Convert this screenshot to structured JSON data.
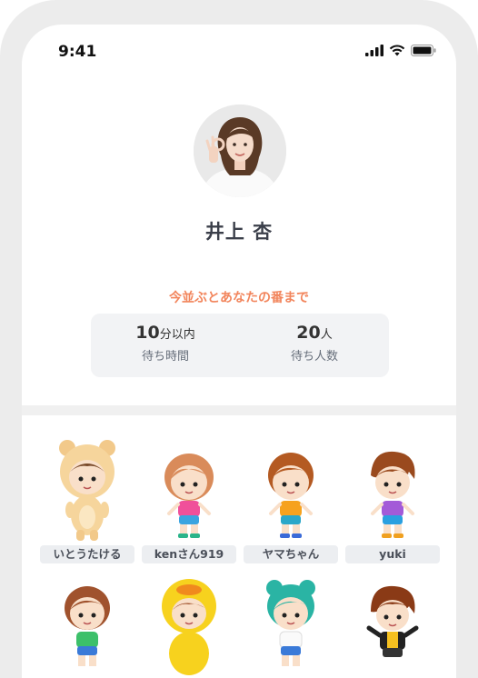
{
  "status_bar": {
    "time": "9:41"
  },
  "profile": {
    "name": "井上 杏"
  },
  "queue": {
    "title": "今並ぶとあなたの番まで",
    "wait_time": {
      "value": "10",
      "unit": "分以内",
      "label": "待ち時間"
    },
    "wait_people": {
      "value": "20",
      "unit": "人",
      "label": "待ち人数"
    }
  },
  "users": [
    {
      "name": "いとうたける",
      "costume": "bear"
    },
    {
      "name": "kenさん919",
      "costume": "pink"
    },
    {
      "name": "ヤマちゃん",
      "costume": "orange"
    },
    {
      "name": "yuki",
      "costume": "purple"
    },
    {
      "name": "",
      "costume": "green"
    },
    {
      "name": "",
      "costume": "duck"
    },
    {
      "name": "",
      "costume": "teal"
    },
    {
      "name": "",
      "costume": "black"
    }
  ],
  "colors": {
    "accent": "#f2855c",
    "name_text": "#3b3f4a",
    "stats_bg": "#f2f3f5",
    "label_bg": "#eceef1"
  }
}
